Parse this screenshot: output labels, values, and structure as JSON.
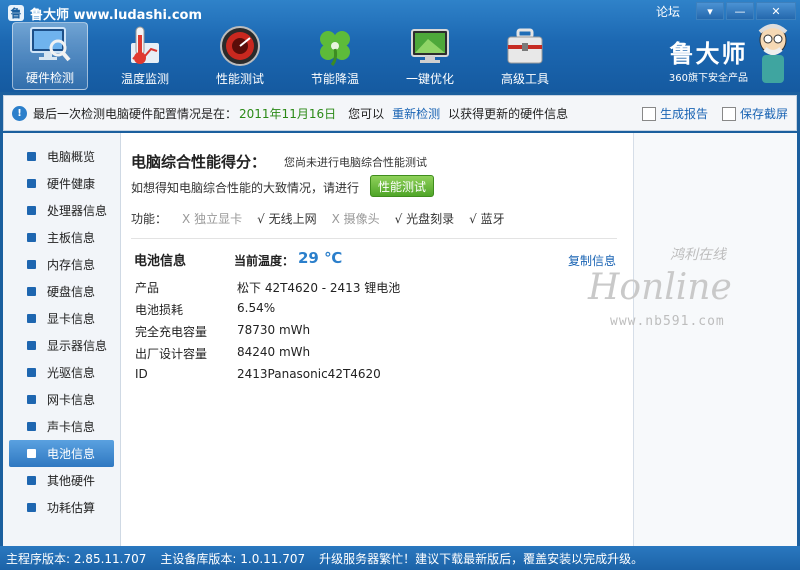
{
  "app": {
    "title": "鲁大师 www.ludashi.com",
    "logo_char": "鲁"
  },
  "window": {
    "forum_link": "论坛",
    "menu_glyph": "▾",
    "min_glyph": "—",
    "close_glyph": "✕"
  },
  "nav": [
    {
      "label": "硬件检测",
      "icon": "monitor-magnifier-icon",
      "active": true
    },
    {
      "label": "温度监测",
      "icon": "thermometer-icon",
      "active": false
    },
    {
      "label": "性能测试",
      "icon": "speedometer-icon",
      "active": false
    },
    {
      "label": "节能降温",
      "icon": "clover-icon",
      "active": false
    },
    {
      "label": "一键优化",
      "icon": "optimize-screen-icon",
      "active": false
    },
    {
      "label": "高级工具",
      "icon": "toolbox-icon",
      "active": false
    }
  ],
  "brand": {
    "name": "鲁大师",
    "tagline": "360旗下安全产品"
  },
  "infobar": {
    "prefix": "最后一次检测电脑硬件配置情况是在：",
    "date": "2011年11月16日",
    "mid": "您可以",
    "redetect": "重新检测",
    "suffix": "以获得更新的硬件信息",
    "report": "生成报告",
    "screenshot": "保存截屏"
  },
  "sidebar": {
    "items": [
      "电脑概览",
      "硬件健康",
      "处理器信息",
      "主板信息",
      "内存信息",
      "硬盘信息",
      "显卡信息",
      "显示器信息",
      "光驱信息",
      "网卡信息",
      "声卡信息",
      "电池信息",
      "其他硬件",
      "功耗估算"
    ],
    "active_index": 11
  },
  "main": {
    "score_title": "电脑综合性能得分：",
    "score_note": "您尚未进行电脑综合性能测试",
    "hint": "如想得知电脑综合性能的大致情况，请进行",
    "perf_button": "性能测试",
    "features_label": "功能：",
    "features": [
      {
        "mark": "X",
        "label": "独立显卡",
        "ok": false
      },
      {
        "mark": "√",
        "label": "无线上网",
        "ok": true
      },
      {
        "mark": "X",
        "label": "摄像头",
        "ok": false
      },
      {
        "mark": "√",
        "label": "光盘刻录",
        "ok": true
      },
      {
        "mark": "√",
        "label": "蓝牙",
        "ok": true
      }
    ],
    "battery_title": "电池信息",
    "temp_label": "当前温度：",
    "temp_value": "29 ℃",
    "copy_link": "复制信息",
    "rows": [
      {
        "key": "产品",
        "value": "松下 42T4620 - 2413 锂电池"
      },
      {
        "key": "电池损耗",
        "value": "6.54%"
      },
      {
        "key": "完全充电容量",
        "value": "78730 mWh"
      },
      {
        "key": "出厂设计容量",
        "value": "84240 mWh"
      },
      {
        "key": "ID",
        "value": "2413Panasonic42T4620"
      }
    ]
  },
  "watermark": {
    "cn": "鸿利在线",
    "en": "Honline",
    "url": "www.nb591.com"
  },
  "status": {
    "version": "主程序版本: 2.85.11.707",
    "db": "主设备库版本: 1.0.11.707",
    "msg": "升级服务器繁忙！建议下载最新版后，覆盖安装以完成升级。"
  },
  "colors": {
    "accent": "#2b7fcb",
    "nav_bg": "#1c68b2",
    "green": "#4fa528"
  }
}
